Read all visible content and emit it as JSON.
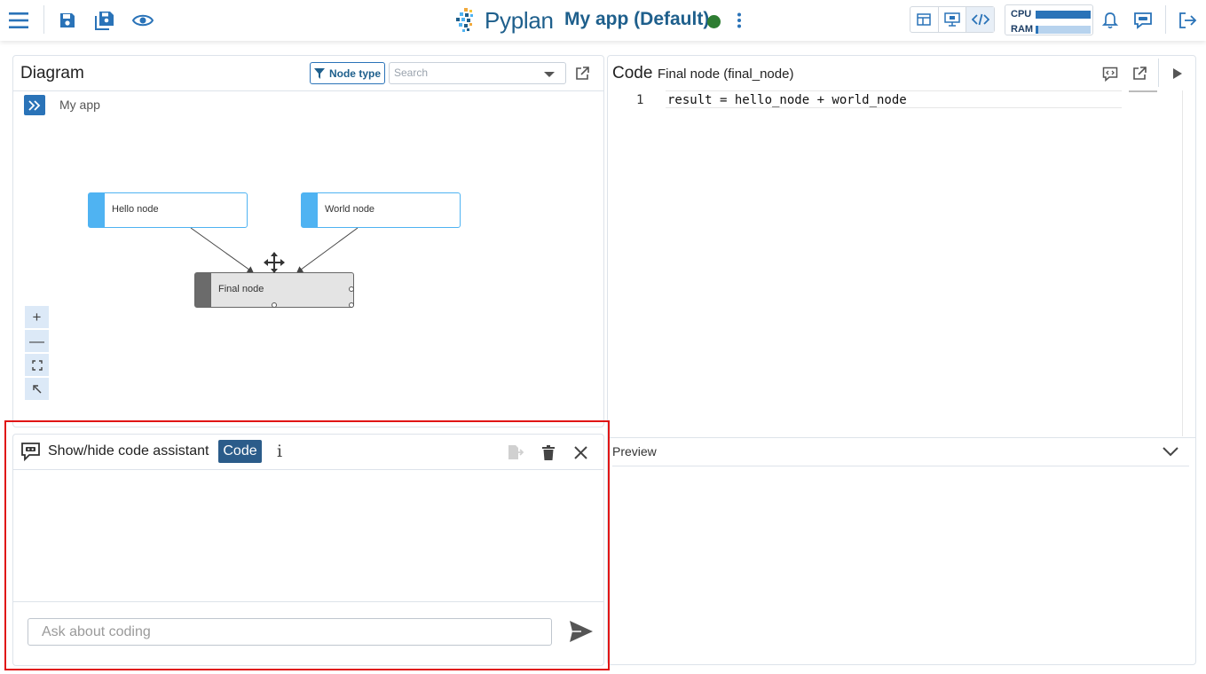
{
  "toolbar": {
    "brand": "Pyplan",
    "app_title": "My app (Default)",
    "status_color": "#2e7d32",
    "resources": {
      "cpu_label": "CPU",
      "cpu_level": 1.0,
      "ram_label": "RAM",
      "ram_level": 0.05
    },
    "icons": [
      "menu-icon",
      "save-icon",
      "save-as-icon",
      "eye-icon",
      "more-vert-icon",
      "table-view-icon",
      "presentation-icon",
      "code-view-icon",
      "bell-icon",
      "chat-icon",
      "logout-icon"
    ]
  },
  "diagram": {
    "title": "Diagram",
    "node_type_label": "Node type",
    "search_placeholder": "Search",
    "breadcrumb": "My app",
    "nodes": [
      {
        "label": "Hello node"
      },
      {
        "label": "World node"
      },
      {
        "label": "Final node"
      }
    ],
    "zoom": {
      "in": "+",
      "out": "—"
    }
  },
  "code": {
    "title": "Code",
    "node_name": "Final node (final_node)",
    "line_number": "1",
    "line": "result = hello_node + world_node"
  },
  "preview": {
    "title": "Preview"
  },
  "assistant": {
    "title": "Show/hide code assistant",
    "mode_badge": "Code",
    "info": "i",
    "input_placeholder": "Ask about coding"
  },
  "colors": {
    "accent": "#2a73b8",
    "brand": "#1e5f8c",
    "node_blue": "#4fb3f2",
    "highlight": "#e01515"
  }
}
